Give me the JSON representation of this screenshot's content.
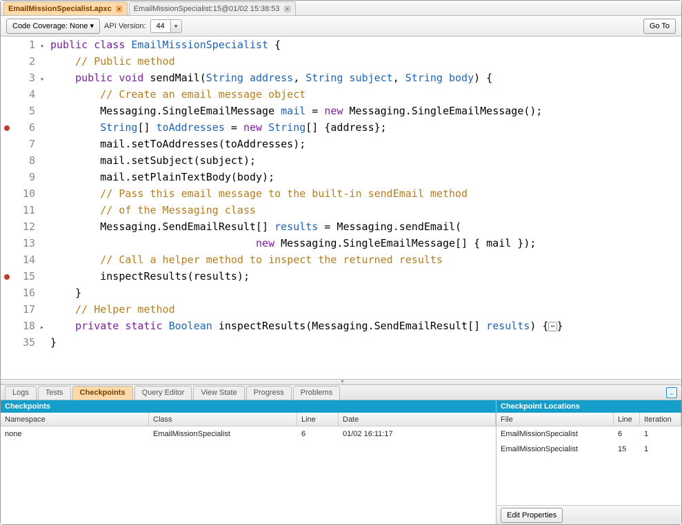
{
  "tabs": [
    {
      "label": "EmailMissionSpecialist.apxc",
      "active": true
    },
    {
      "label": "EmailMissionSpecialist:15@01/02 15:38:53",
      "active": false
    }
  ],
  "toolbar": {
    "coverage_label": "Code Coverage: None",
    "api_label": "API Version:",
    "api_value": "44",
    "goto_label": "Go To"
  },
  "code": [
    {
      "n": "1",
      "fold": "▾",
      "bp": false,
      "html": "<span class='kw'>public</span> <span class='kw'>class</span> <span class='type'>EmailMissionSpecialist</span> {"
    },
    {
      "n": "2",
      "fold": "",
      "bp": false,
      "html": "    <span class='cm'>// Public method</span>"
    },
    {
      "n": "3",
      "fold": "▾",
      "bp": false,
      "html": "    <span class='kw'>public</span> <span class='kw'>void</span> sendMail(<span class='type'>String</span> <span class='str-id'>address</span>, <span class='type'>String</span> <span class='str-id'>subject</span>, <span class='type'>String</span> <span class='str-id'>body</span>) {"
    },
    {
      "n": "4",
      "fold": "",
      "bp": false,
      "html": "        <span class='cm'>// Create an email message object</span>"
    },
    {
      "n": "5",
      "fold": "",
      "bp": false,
      "html": "        Messaging.SingleEmailMessage <span class='str-id'>mail</span> = <span class='kw'>new</span> Messaging.SingleEmailMessage();"
    },
    {
      "n": "6",
      "fold": "",
      "bp": true,
      "html": "        <span class='type'>String</span>[] <span class='str-id'>toAddresses</span> = <span class='kw'>new</span> <span class='type'>String</span>[] {address};"
    },
    {
      "n": "7",
      "fold": "",
      "bp": false,
      "html": "        mail.setToAddresses(toAddresses);"
    },
    {
      "n": "8",
      "fold": "",
      "bp": false,
      "html": "        mail.setSubject(subject);"
    },
    {
      "n": "9",
      "fold": "",
      "bp": false,
      "html": "        mail.setPlainTextBody(body);"
    },
    {
      "n": "10",
      "fold": "",
      "bp": false,
      "html": "        <span class='cm'>// Pass this email message to the built-in sendEmail method</span>"
    },
    {
      "n": "11",
      "fold": "",
      "bp": false,
      "html": "        <span class='cm'>// of the Messaging class</span>"
    },
    {
      "n": "12",
      "fold": "",
      "bp": false,
      "html": "        Messaging.SendEmailResult[] <span class='str-id'>results</span> = Messaging.sendEmail("
    },
    {
      "n": "13",
      "fold": "",
      "bp": false,
      "html": "                                 <span class='kw'>new</span> Messaging.SingleEmailMessage[] { mail });"
    },
    {
      "n": "14",
      "fold": "",
      "bp": false,
      "html": "        <span class='cm'>// Call a helper method to inspect the returned results</span>"
    },
    {
      "n": "15",
      "fold": "",
      "bp": true,
      "html": "        inspectResults(results);"
    },
    {
      "n": "16",
      "fold": "",
      "bp": false,
      "html": "    }"
    },
    {
      "n": "17",
      "fold": "",
      "bp": false,
      "html": "    <span class='cm'>// Helper method</span>"
    },
    {
      "n": "18",
      "fold": "▸",
      "bp": false,
      "html": "    <span class='kw'>private</span> <span class='kw'>static</span> <span class='type'>Boolean</span> inspectResults(Messaging.SendEmailResult[] <span class='str-id'>results</span>) {<span class='fold-box'>↔</span>}"
    },
    {
      "n": "35",
      "fold": "",
      "bp": false,
      "html": "}"
    }
  ],
  "bottom_tabs": [
    {
      "label": "Logs",
      "active": false
    },
    {
      "label": "Tests",
      "active": false
    },
    {
      "label": "Checkpoints",
      "active": true
    },
    {
      "label": "Query Editor",
      "active": false
    },
    {
      "label": "View State",
      "active": false
    },
    {
      "label": "Progress",
      "active": false
    },
    {
      "label": "Problems",
      "active": false
    }
  ],
  "checkpoints_panel": {
    "title": "Checkpoints",
    "headers": {
      "ns": "Namespace",
      "cls": "Class",
      "ln": "Line",
      "dt": "Date"
    },
    "rows": [
      {
        "ns": "none",
        "cls": "EmailMissionSpecialist",
        "ln": "6",
        "dt": "01/02 16:11:17"
      }
    ]
  },
  "locations_panel": {
    "title": "Checkpoint Locations",
    "headers": {
      "file": "File",
      "ln": "Line",
      "it": "Iteration"
    },
    "rows": [
      {
        "file": "EmailMissionSpecialist",
        "ln": "6",
        "it": "1"
      },
      {
        "file": "EmailMissionSpecialist",
        "ln": "15",
        "it": "1"
      }
    ],
    "edit_btn": "Edit Properties"
  }
}
